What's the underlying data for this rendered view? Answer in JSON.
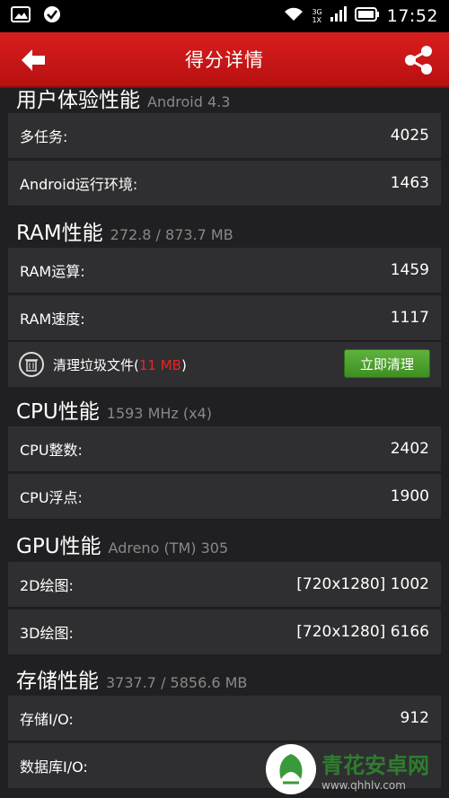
{
  "status_bar": {
    "time": "17:52",
    "net_top": "3G",
    "net_bottom": "1X",
    "icons": [
      "image-icon",
      "check-icon",
      "wifi-icon",
      "signal-icon",
      "battery-icon"
    ]
  },
  "app_bar": {
    "title": "得分详情",
    "back_icon": "back-arrow-icon",
    "share_icon": "share-icon",
    "color": "#c8161a"
  },
  "sections": [
    {
      "title": "用户体验性能",
      "subtitle": "Android 4.3",
      "rows": [
        {
          "label": "多任务:",
          "value": "4025"
        },
        {
          "label": "Android运行环境:",
          "value": "1463"
        }
      ]
    },
    {
      "title": "RAM性能",
      "subtitle": "272.8 / 873.7 MB",
      "rows": [
        {
          "label": "RAM运算:",
          "value": "1459"
        },
        {
          "label": "RAM速度:",
          "value": "1117"
        }
      ]
    },
    {
      "title": "CPU性能",
      "subtitle": "1593 MHz (x4)",
      "rows": [
        {
          "label": "CPU整数:",
          "value": "2402"
        },
        {
          "label": "CPU浮点:",
          "value": "1900"
        }
      ]
    },
    {
      "title": "GPU性能",
      "subtitle": "Adreno (TM) 305",
      "rows": [
        {
          "label": "2D绘图:",
          "value": "[720x1280] 1002"
        },
        {
          "label": "3D绘图:",
          "value": "[720x1280] 6166"
        }
      ]
    },
    {
      "title": "存储性能",
      "subtitle": "3737.7 / 5856.6 MB",
      "rows": [
        {
          "label": "存储I/O:",
          "value": "912"
        },
        {
          "label": "数据库I/O:",
          "value": ""
        }
      ]
    }
  ],
  "clean": {
    "text_prefix": "清理垃圾文件(",
    "size": "11 MB",
    "text_suffix": ")",
    "button_label": "立即清理",
    "button_color": "#4ea32e"
  },
  "watermark": {
    "name": "青花安卓网",
    "url": "www.qhhlv.com"
  }
}
